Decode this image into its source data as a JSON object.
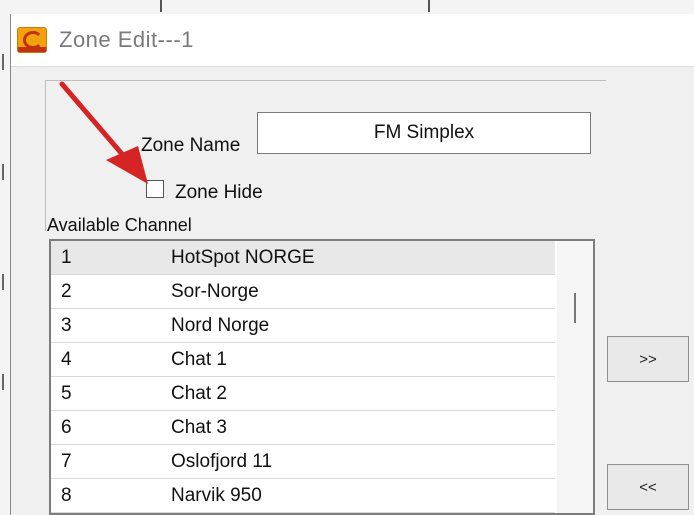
{
  "dialog": {
    "title": "Zone Edit---1",
    "zone_name_label": "Zone Name",
    "zone_name_value": "FM Simplex",
    "zone_hide_label": "Zone Hide",
    "zone_hide_checked": false,
    "available_channel_label": "Available Channel",
    "channels": [
      {
        "num": "1",
        "name": "HotSpot NORGE"
      },
      {
        "num": "2",
        "name": "Sor-Norge"
      },
      {
        "num": "3",
        "name": "Nord Norge"
      },
      {
        "num": "4",
        "name": "Chat 1"
      },
      {
        "num": "5",
        "name": "Chat 2"
      },
      {
        "num": "6",
        "name": "Chat 3"
      },
      {
        "num": "7",
        "name": "Oslofjord 11"
      },
      {
        "num": "8",
        "name": "Narvik 950"
      }
    ],
    "add_button_label": ">>",
    "remove_button_label": "<<"
  },
  "colors": {
    "annotation_arrow": "#d42424",
    "selected_row": "#e8e8e8"
  }
}
